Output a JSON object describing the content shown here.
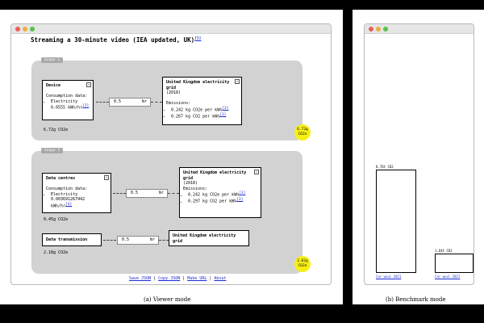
{
  "viewer": {
    "title": "Streaming a 30-minute video (IEA updated, UK)",
    "title_ref": "[1]",
    "scope2": {
      "tag": "Scope 2",
      "device": {
        "title": "Device",
        "consumption_label": "Consumption data:",
        "item_name": "Electricity",
        "item_value": "0.0555 kWh/hr",
        "item_ref": "[2]",
        "total": "6.72g CO2e"
      },
      "input": {
        "value": "0.5",
        "unit": "hr"
      },
      "grid": {
        "title": "United Kingdom electricity grid",
        "year": "(2018)",
        "emissions_label": "Emissions:",
        "e1": "0.242 kg CO2e per kWh",
        "e1_ref": "[3]",
        "e2": "0.267 kg CO2 per kWh",
        "e2_ref": "[3]"
      },
      "bubble": {
        "value": "6.72g",
        "unit": "CO2e"
      }
    },
    "scope3": {
      "tag": "Scope 3",
      "datacentres": {
        "title": "Data centres",
        "consumption_label": "Consumption data:",
        "item_name": "Electricity",
        "item_value": "0.003691267442 kWh/hr",
        "item_ref": "[4]",
        "total": "0.45g CO2e"
      },
      "input1": {
        "value": "0.5",
        "unit": "hr"
      },
      "grid": {
        "title": "United Kingdom electricity grid",
        "year": "(2018)",
        "emissions_label": "Emissions:",
        "e1": "0.242 kg CO2e per kWh",
        "e1_ref": "[3]",
        "e2": "0.297 kg CO2 per kWh",
        "e2_ref": "[3]"
      },
      "transmission": {
        "title": "Data transmission",
        "total": "2.18g CO2e"
      },
      "input2": {
        "value": "0.5",
        "unit": "hr"
      },
      "grid2": {
        "title": "United Kingdom electricity grid"
      },
      "bubble": {
        "value": "2.62g",
        "unit": "CO2e"
      }
    },
    "footer": {
      "save_json": "Save JSON",
      "copy_json": "Copy JSON",
      "make_url": "Make URL",
      "about": "About",
      "sep": "|"
    },
    "caption": "(a) Viewer mode"
  },
  "benchmark": {
    "caption": "(b) Benchmark mode",
    "chart_data": {
      "type": "bar",
      "categories": [
        "Carwoul 2021",
        "Carwoul 2021"
      ],
      "values": [
        8.7,
        1.6
      ],
      "value_labels": [
        "8.76t CO2",
        "1.64t CO2"
      ],
      "source_labels": [
        "Car woul 2021",
        "Car woul 2021"
      ]
    }
  }
}
